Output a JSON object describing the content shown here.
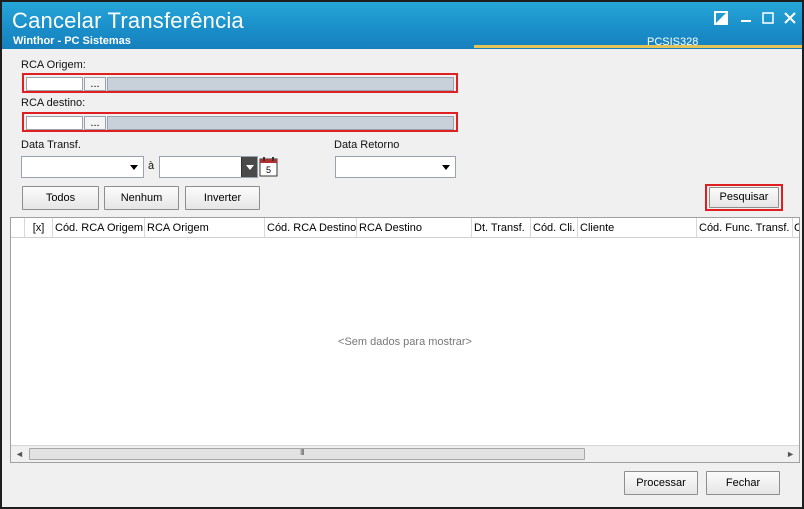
{
  "window": {
    "title": "Cancelar Transferência",
    "subtitle": "Winthor - PC Sistemas",
    "code": "PCSIS328"
  },
  "form": {
    "rca_origem_label": "RCA Origem:",
    "rca_destino_label": "RCA destino:",
    "lookup_button": "...",
    "data_transf_label": "Data Transf.",
    "between_label": "à",
    "data_retorno_label": "Data Retorno",
    "calendar_icon_text": "5"
  },
  "buttons": {
    "todos": "Todos",
    "nenhum": "Nenhum",
    "inverter": "Inverter",
    "pesquisar": "Pesquisar",
    "processar": "Processar",
    "fechar": "Fechar"
  },
  "grid": {
    "columns": [
      "[x]",
      "Cód. RCA Origem",
      "RCA Origem",
      "Cód. RCA Destino",
      "RCA Destino",
      "Dt. Transf.",
      "Cód. Cli.",
      "Cliente",
      "Cód. Func. Transf.",
      "C"
    ],
    "empty_message": "<Sem dados para mostrar>",
    "scroll_left": "◄",
    "scroll_right": "►",
    "scroll_grip": "III"
  },
  "colors": {
    "titlebar": "#1a8fc9",
    "highlight": "#e02020",
    "accent_line": "#e4c45a"
  }
}
